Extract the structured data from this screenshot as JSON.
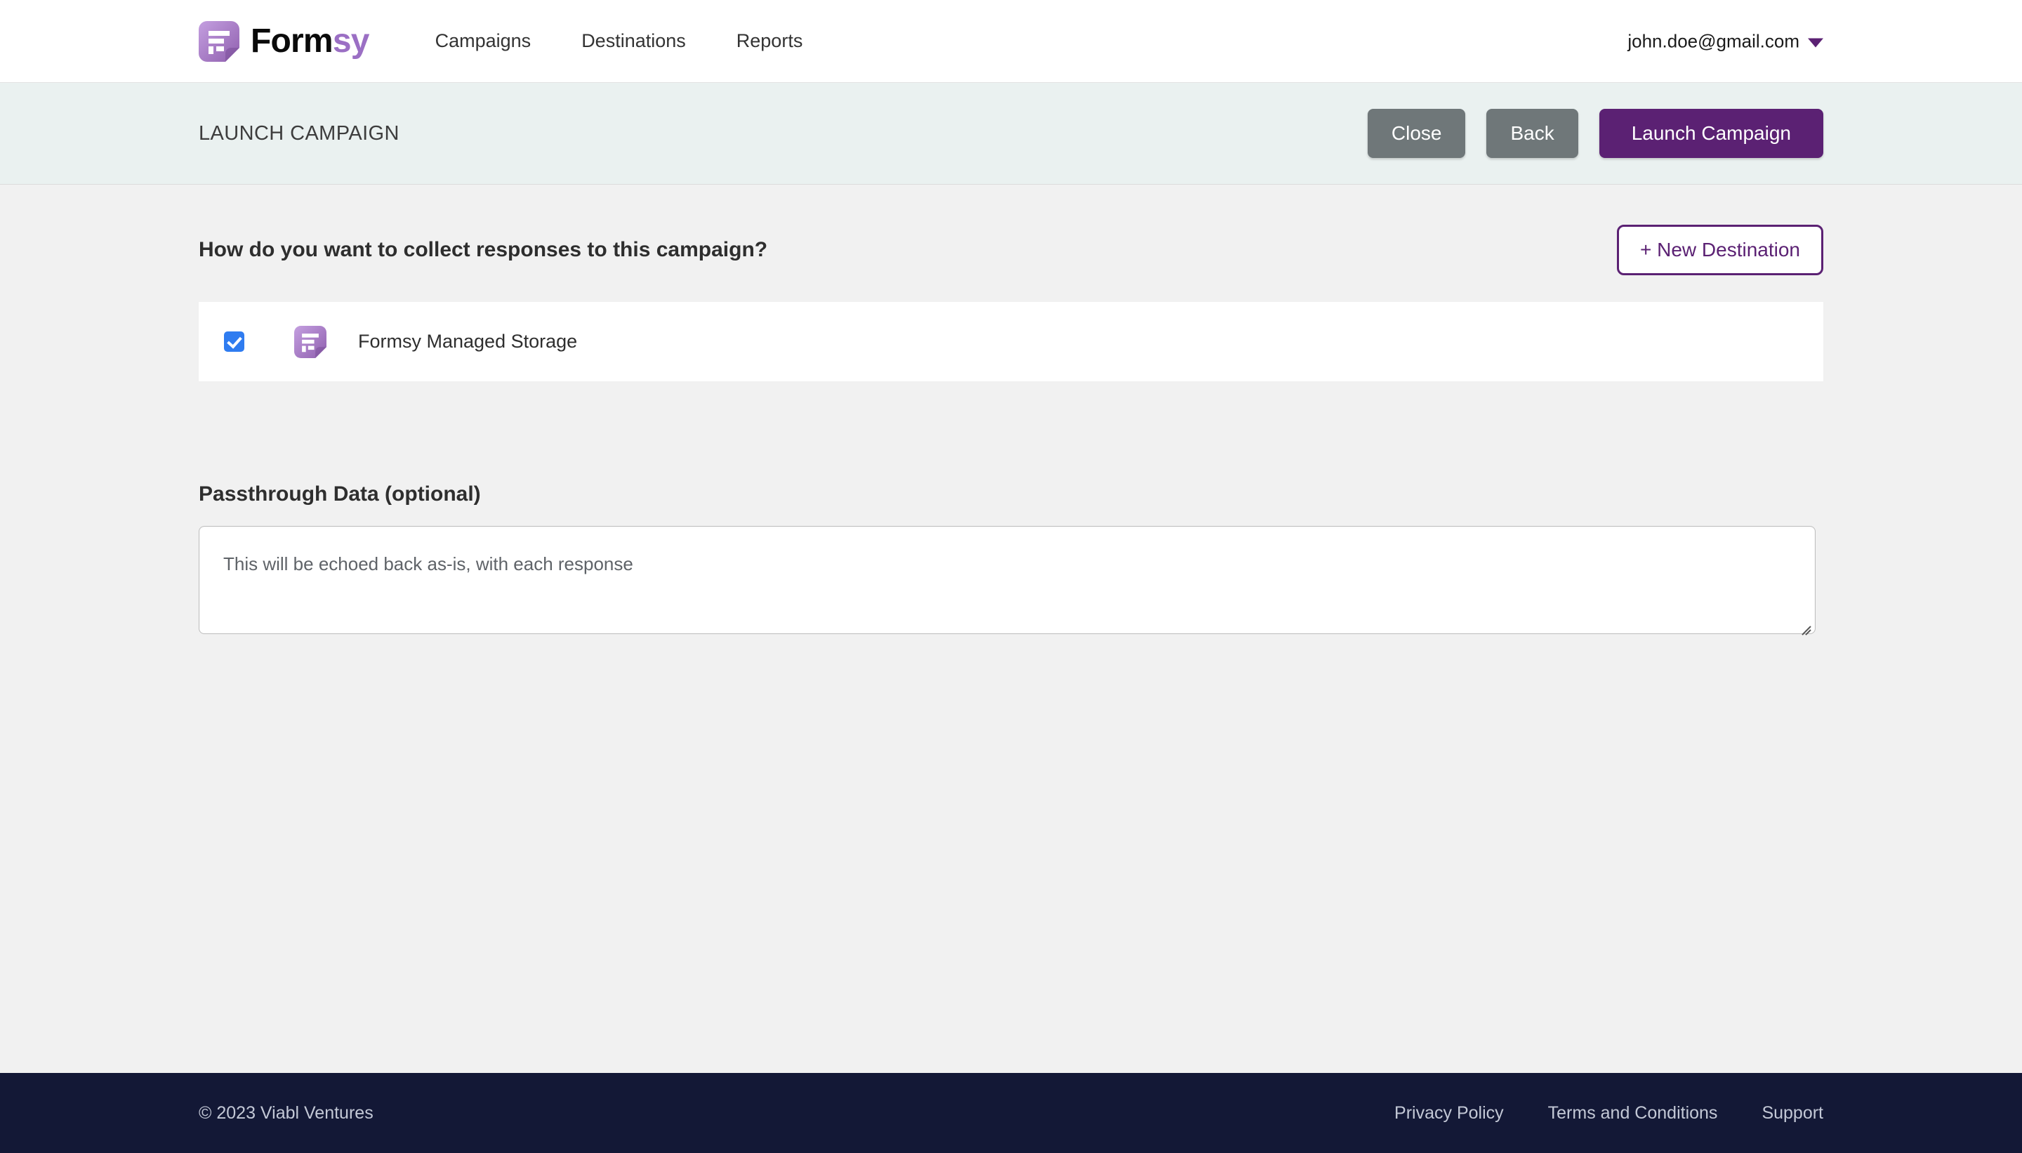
{
  "brand": {
    "name_dark": "Form",
    "name_accent": "sy",
    "logo_icon": "formsy-logo-icon",
    "accent_color": "#9b6fc4"
  },
  "nav": {
    "links": [
      {
        "label": "Campaigns"
      },
      {
        "label": "Destinations"
      },
      {
        "label": "Reports"
      }
    ]
  },
  "account": {
    "email": "john.doe@gmail.com",
    "caret_icon": "chevron-down-icon"
  },
  "subheader": {
    "title": "LAUNCH CAMPAIGN",
    "close_label": "Close",
    "back_label": "Back",
    "launch_label": "Launch Campaign",
    "primary_color": "#5b2173",
    "secondary_color": "#6f7779",
    "background": "#eaf1f0"
  },
  "main": {
    "question": "How do you want to collect responses to this campaign?",
    "new_destination_label": "+ New Destination",
    "destinations": [
      {
        "checked": true,
        "icon": "formsy-logo-icon",
        "label": "Formsy Managed Storage"
      }
    ],
    "passthrough": {
      "label": "Passthrough Data (optional)",
      "value": "",
      "placeholder": "This will be echoed back as-is, with each response"
    }
  },
  "footer": {
    "copyright": "© 2023 Viabl Ventures",
    "links": [
      {
        "label": "Privacy Policy"
      },
      {
        "label": "Terms and Conditions"
      },
      {
        "label": "Support"
      }
    ],
    "background": "#131836"
  }
}
